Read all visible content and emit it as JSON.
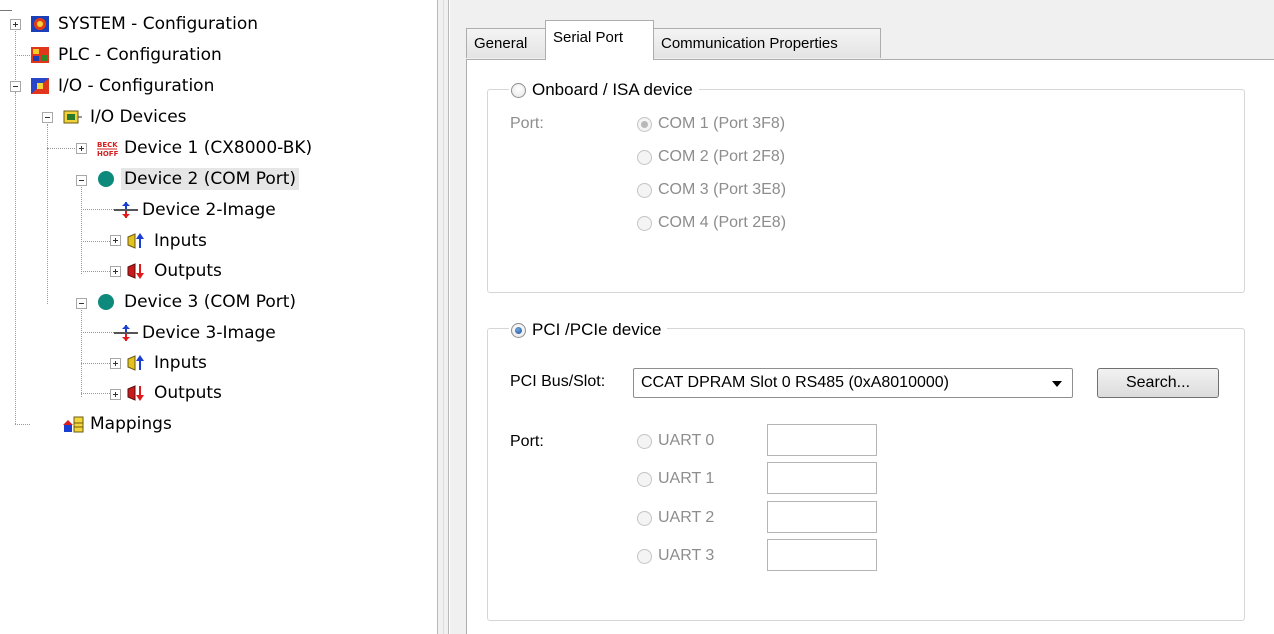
{
  "tree": {
    "system": "SYSTEM - Configuration",
    "plc": "PLC - Configuration",
    "io": "I/O - Configuration",
    "io_devices": "I/O Devices",
    "device1": "Device 1 (CX8000-BK)",
    "device1_logo": "BECKHOFF",
    "device2": "Device 2 (COM Port)",
    "device2_image": "Device 2-Image",
    "device2_inputs": "Inputs",
    "device2_outputs": "Outputs",
    "device3": "Device 3 (COM Port)",
    "device3_image": "Device 3-Image",
    "device3_inputs": "Inputs",
    "device3_outputs": "Outputs",
    "mappings": "Mappings"
  },
  "tabs": [
    "General",
    "Serial Port",
    "Communication Properties"
  ],
  "onboard": {
    "legend": "Onboard / ISA device",
    "port_label": "Port:",
    "options": [
      "COM 1 (Port 3F8)",
      "COM 2 (Port 2F8)",
      "COM 3 (Port 3E8)",
      "COM 4 (Port 2E8)"
    ],
    "selected_index": 0
  },
  "pci": {
    "legend": "PCI /PCIe device",
    "bus_label": "PCI Bus/Slot:",
    "bus_value": "CCAT DPRAM Slot 0 RS485 (0xA8010000)",
    "search_button": "Search...",
    "port_label": "Port:",
    "uarts": [
      "UART 0",
      "UART 1",
      "UART 2",
      "UART 3"
    ],
    "uart_values": [
      "",
      "",
      "",
      ""
    ]
  },
  "colors": {
    "accent": "#1f4e9a",
    "disabled_text": "#8d8d8d",
    "panel_bg": "#f0f0f0",
    "selection": "#e6e6e6"
  }
}
